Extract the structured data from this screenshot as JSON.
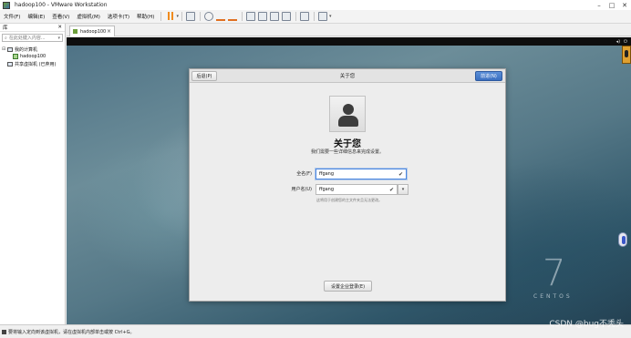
{
  "window": {
    "title": "hadoop100 - VMware Workstation"
  },
  "menu": {
    "items": [
      "文件(F)",
      "编辑(E)",
      "查看(V)",
      "虚拟机(M)",
      "选项卡(T)",
      "帮助(H)"
    ]
  },
  "library": {
    "title": "库",
    "search_placeholder": "在此处键入内容...",
    "tree": {
      "root": "我的计算机",
      "vm": "hadoop100",
      "shared": "共享虚拟机 (已弃用)"
    }
  },
  "tabs": [
    {
      "label": "hadoop100"
    }
  ],
  "dialog": {
    "back_label": "后退(P)",
    "title": "关于您",
    "next_label": "前进(N)",
    "heading": "关于您",
    "subtitle": "我们需要一些详细信息来完成设置。",
    "fullname_label": "全名(F)",
    "fullname_value": "ffgang",
    "username_label": "用户名(U)",
    "username_value": "ffgang",
    "hint": "这将用于创建您的主文件夹且无法更改。",
    "enterprise_label": "设置企业登录(E)"
  },
  "desktop": {
    "version_mark": "7",
    "brand": "CENTOS"
  },
  "status": {
    "text": "要将输入定向到该虚拟机，请在虚拟机内部单击或按 Ctrl+G。"
  },
  "watermark": "CSDN @bug不秃头",
  "icons": [
    "app-icon",
    "pause-icon",
    "snapshot-icon",
    "fullscreen-icon",
    "console-icon",
    "check-icon",
    "avatar-icon",
    "close-icon"
  ]
}
